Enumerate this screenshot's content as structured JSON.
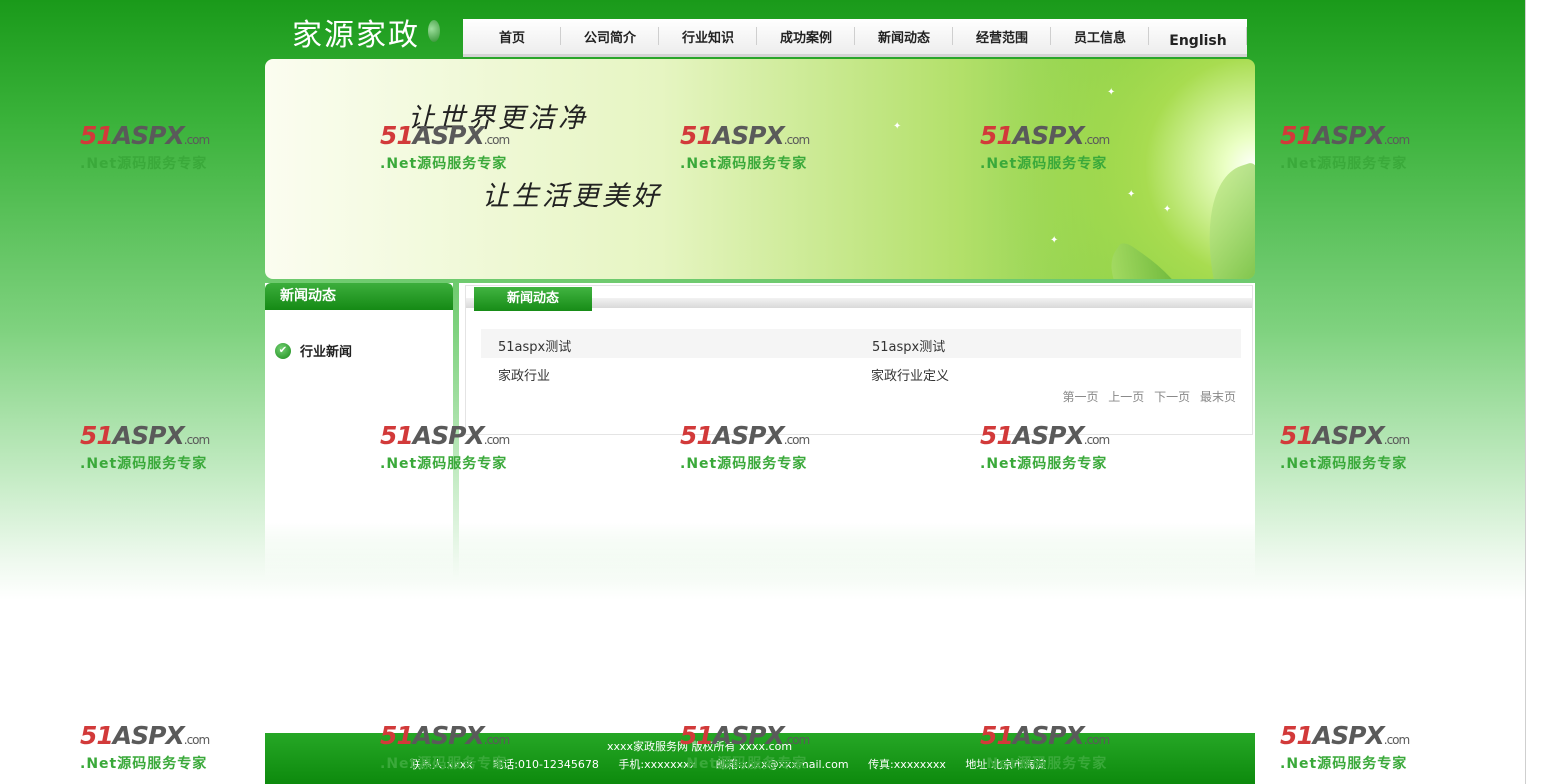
{
  "logo": "家源家政",
  "nav": [
    "首页",
    "公司简介",
    "行业知识",
    "成功案例",
    "新闻动态",
    "经营范围",
    "员工信息",
    "English"
  ],
  "banner": {
    "line1": "让世界更洁净",
    "line2": "让生活更美好"
  },
  "sidebar": {
    "title": "新闻动态",
    "items": [
      {
        "label": "行业新闻"
      }
    ]
  },
  "main": {
    "tab": "新闻动态",
    "rows": [
      {
        "left": "51aspx测试",
        "right": "51aspx测试"
      },
      {
        "left": "家政行业",
        "right": "家政行业定义"
      }
    ],
    "pager": [
      "第一页",
      "上一页",
      "下一页",
      "最末页"
    ]
  },
  "footer": {
    "line1": "xxxx家政服务网 版权所有 xxxx.com",
    "contact": "联系人:xxxx",
    "phone": "电话:010-12345678",
    "mobile": "手机:xxxxxxxx",
    "email": "邮箱:xxxx@xxxmail.com",
    "fax": "传真:xxxxxxxx",
    "address": "地址:北京市海淀"
  },
  "watermark": {
    "brand_red": "51",
    "brand_gray": "ASPX",
    "domain": ".com",
    "tagline": ".Net源码服务专家"
  }
}
